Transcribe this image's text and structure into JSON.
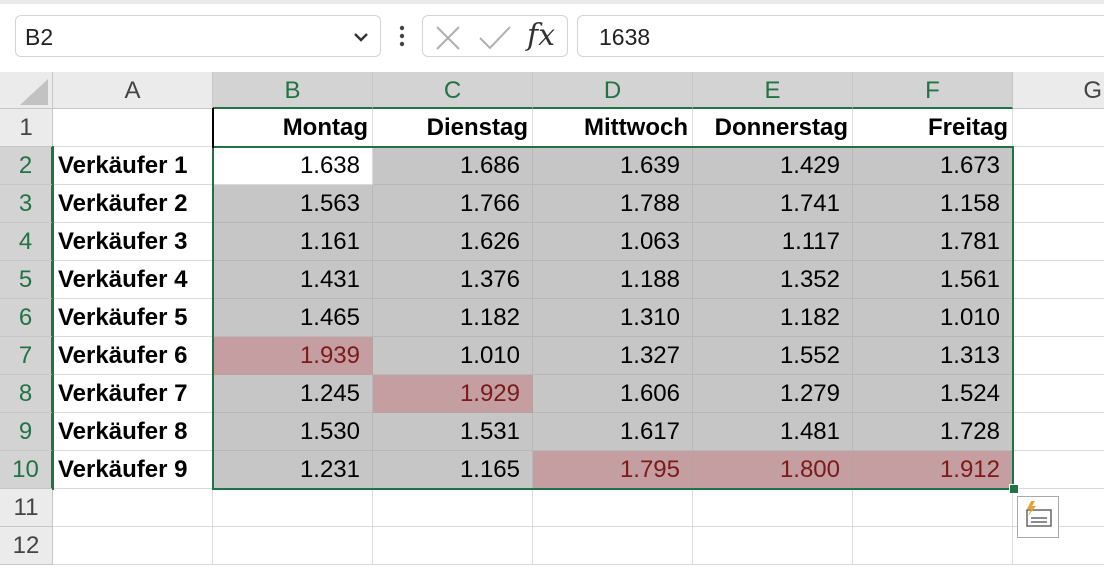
{
  "name_box": {
    "value": "B2"
  },
  "formula_bar": {
    "value": "1638",
    "fx_label": "fx"
  },
  "columns": [
    "A",
    "B",
    "C",
    "D",
    "E",
    "F",
    "G"
  ],
  "rows": [
    "1",
    "2",
    "3",
    "4",
    "5",
    "6",
    "7",
    "8",
    "9",
    "10",
    "11",
    "12"
  ],
  "header_row": [
    "",
    "Montag",
    "Dienstag",
    "Mittwoch",
    "Donnerstag",
    "Freitag"
  ],
  "data_rows": [
    {
      "label": "Verkäufer 1",
      "values": [
        "1.638",
        "1.686",
        "1.639",
        "1.429",
        "1.673"
      ],
      "highlight": [
        false,
        false,
        false,
        false,
        false
      ]
    },
    {
      "label": "Verkäufer 2",
      "values": [
        "1.563",
        "1.766",
        "1.788",
        "1.741",
        "1.158"
      ],
      "highlight": [
        false,
        false,
        false,
        false,
        false
      ]
    },
    {
      "label": "Verkäufer 3",
      "values": [
        "1.161",
        "1.626",
        "1.063",
        "1.117",
        "1.781"
      ],
      "highlight": [
        false,
        false,
        false,
        false,
        false
      ]
    },
    {
      "label": "Verkäufer 4",
      "values": [
        "1.431",
        "1.376",
        "1.188",
        "1.352",
        "1.561"
      ],
      "highlight": [
        false,
        false,
        false,
        false,
        false
      ]
    },
    {
      "label": "Verkäufer 5",
      "values": [
        "1.465",
        "1.182",
        "1.310",
        "1.182",
        "1.010"
      ],
      "highlight": [
        false,
        false,
        false,
        false,
        false
      ]
    },
    {
      "label": "Verkäufer 6",
      "values": [
        "1.939",
        "1.010",
        "1.327",
        "1.552",
        "1.313"
      ],
      "highlight": [
        true,
        false,
        false,
        false,
        false
      ]
    },
    {
      "label": "Verkäufer 7",
      "values": [
        "1.245",
        "1.929",
        "1.606",
        "1.279",
        "1.524"
      ],
      "highlight": [
        false,
        true,
        false,
        false,
        false
      ]
    },
    {
      "label": "Verkäufer 8",
      "values": [
        "1.530",
        "1.531",
        "1.617",
        "1.481",
        "1.728"
      ],
      "highlight": [
        false,
        false,
        false,
        false,
        false
      ]
    },
    {
      "label": "Verkäufer 9",
      "values": [
        "1.231",
        "1.165",
        "1.795",
        "1.800",
        "1.912"
      ],
      "highlight": [
        false,
        false,
        true,
        true,
        true
      ]
    }
  ],
  "selection": {
    "active_cell": "B2",
    "range": "B2:F10"
  },
  "colors": {
    "accent": "#217346",
    "selected_fill": "#c6c6c6",
    "highlight_fill": "#c49ea1",
    "highlight_text": "#7a1a1a"
  },
  "icons": {
    "name_box_dropdown": "chevron-down-icon",
    "more": "more-vertical-icon",
    "cancel": "x-icon",
    "enter": "check-icon",
    "function": "fx-icon",
    "quick_analysis": "quick-analysis-icon"
  }
}
